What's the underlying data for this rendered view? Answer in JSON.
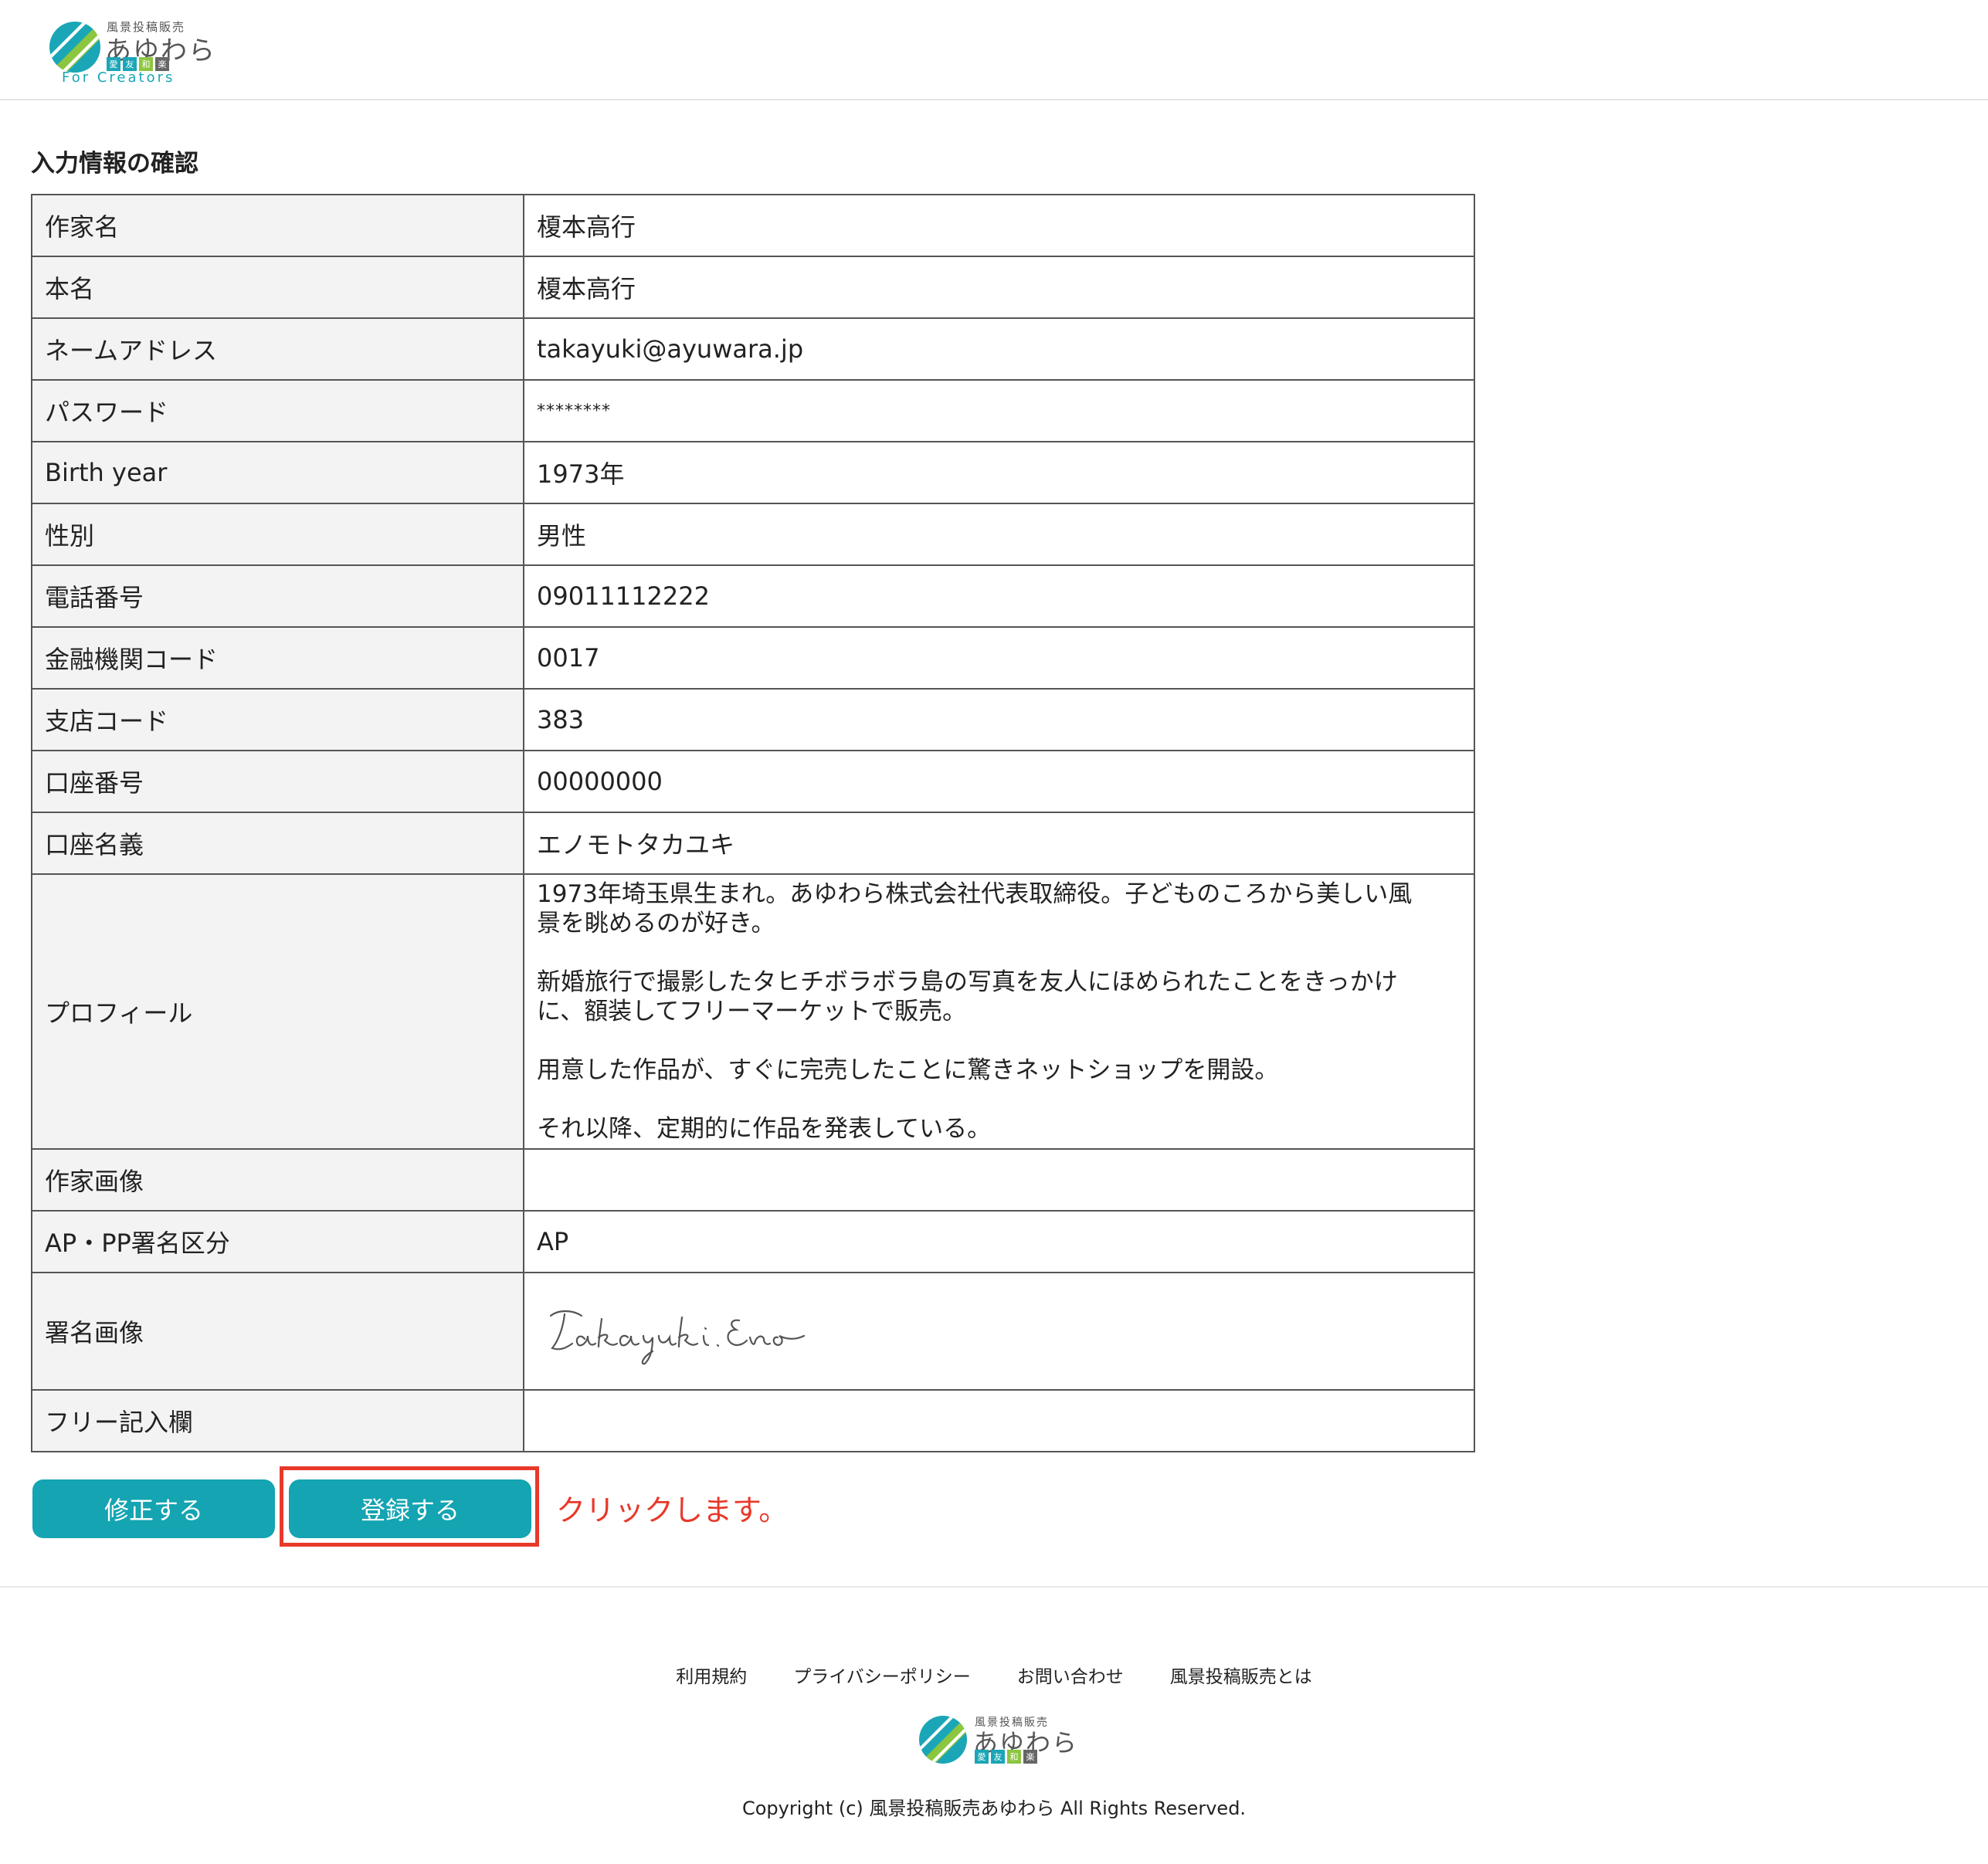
{
  "brand": {
    "small": "風景投稿販売",
    "main": "あゆわら",
    "tags": [
      "愛",
      "友",
      "和",
      "楽"
    ],
    "tagline": "For Creators",
    "colors": {
      "teal": "#1aa6b7",
      "green": "#8cc63f",
      "gray": "#666666"
    }
  },
  "page": {
    "title": "入力情報の確認"
  },
  "rows": [
    {
      "label": "作家名",
      "value": "榎本高行"
    },
    {
      "label": "本名",
      "value": "榎本高行"
    },
    {
      "label": "ネームアドレス",
      "value": "takayuki@ayuwara.jp"
    },
    {
      "label": "パスワード",
      "value": "********"
    },
    {
      "label": "Birth year",
      "value": "1973年"
    },
    {
      "label": "性別",
      "value": "男性"
    },
    {
      "label": "電話番号",
      "value": "09011112222"
    },
    {
      "label": "金融機関コード",
      "value": "0017"
    },
    {
      "label": "支店コード",
      "value": "383"
    },
    {
      "label": "口座番号",
      "value": "00000000"
    },
    {
      "label": "口座名義",
      "value": "エノモトタカユキ"
    },
    {
      "label": "プロフィール",
      "value": "1973年埼玉県生まれ。あゆわら株式会社代表取締役。子どものころから美しい風\n景を眺めるのが好き。\n\n新婚旅行で撮影したタヒチボラボラ島の写真を友人にほめられたことをきっかけ\nに、額装してフリーマーケットで販売。\n\n用意した作品が、すぐに完売したことに驚きネットショップを開設。\n\nそれ以降、定期的に作品を発表している。"
    },
    {
      "label": "作家画像",
      "value": ""
    },
    {
      "label": "AP・PP署名区分",
      "value": "AP"
    },
    {
      "label": "署名画像",
      "value": "Takayuki.Eno"
    },
    {
      "label": "フリー記入欄",
      "value": ""
    }
  ],
  "buttons": {
    "edit": "修正する",
    "register": "登録する"
  },
  "annotation": "クリックします。",
  "footer": {
    "links": [
      "利用規約",
      "プライバシーポリシー",
      "お問い合わせ",
      "風景投稿販売とは"
    ],
    "copyright": "Copyright (c) 風景投稿販売あゆわら All Rights Reserved."
  }
}
